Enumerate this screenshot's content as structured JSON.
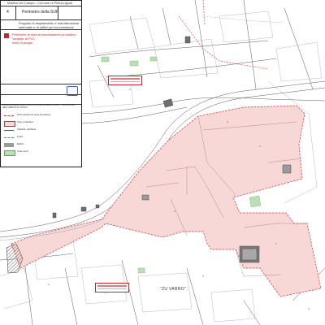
{
  "title_block": {
    "row1": "Mattino del Campo - Comune di Pietra Ligure",
    "sheet_no": "4",
    "sheet_title": "Perimetro della SUP",
    "description_line1": "Progetto di ampliamento e ristrutturazione",
    "description_line2": "aziendale e di edifici per riconversione",
    "legend_note_1": "Perimetro di area di insediamento produttivo",
    "legend_note_2": "Variante di PUC",
    "legend_note_3": "Aree di pregio"
  },
  "legend": {
    "header": "LEGENDA DELLE PREVISIONI DI PIANO IN AREA PRODUTTIVA INCLUSA NELL'AMBITO DI STUDIO",
    "items": [
      {
        "label": "Perimetrazione area produttiva",
        "style": "red-dash"
      },
      {
        "label": "Aree produttive",
        "style": "pink"
      },
      {
        "label": "Viabilita' pubblica",
        "style": "line"
      },
      {
        "label": "Fossi",
        "style": "blue"
      },
      {
        "label": "Edifici",
        "style": "grey"
      },
      {
        "label": "Aree verdi",
        "style": "green"
      }
    ]
  },
  "map": {
    "place_label": "\"ZU VARRO\"",
    "colors": {
      "zone_fill": "#f8d7d7",
      "zone_stroke": "#d1303a",
      "linework": "#555555",
      "green_patch": "#b9e0b3",
      "building": "#6f6f6f"
    }
  }
}
